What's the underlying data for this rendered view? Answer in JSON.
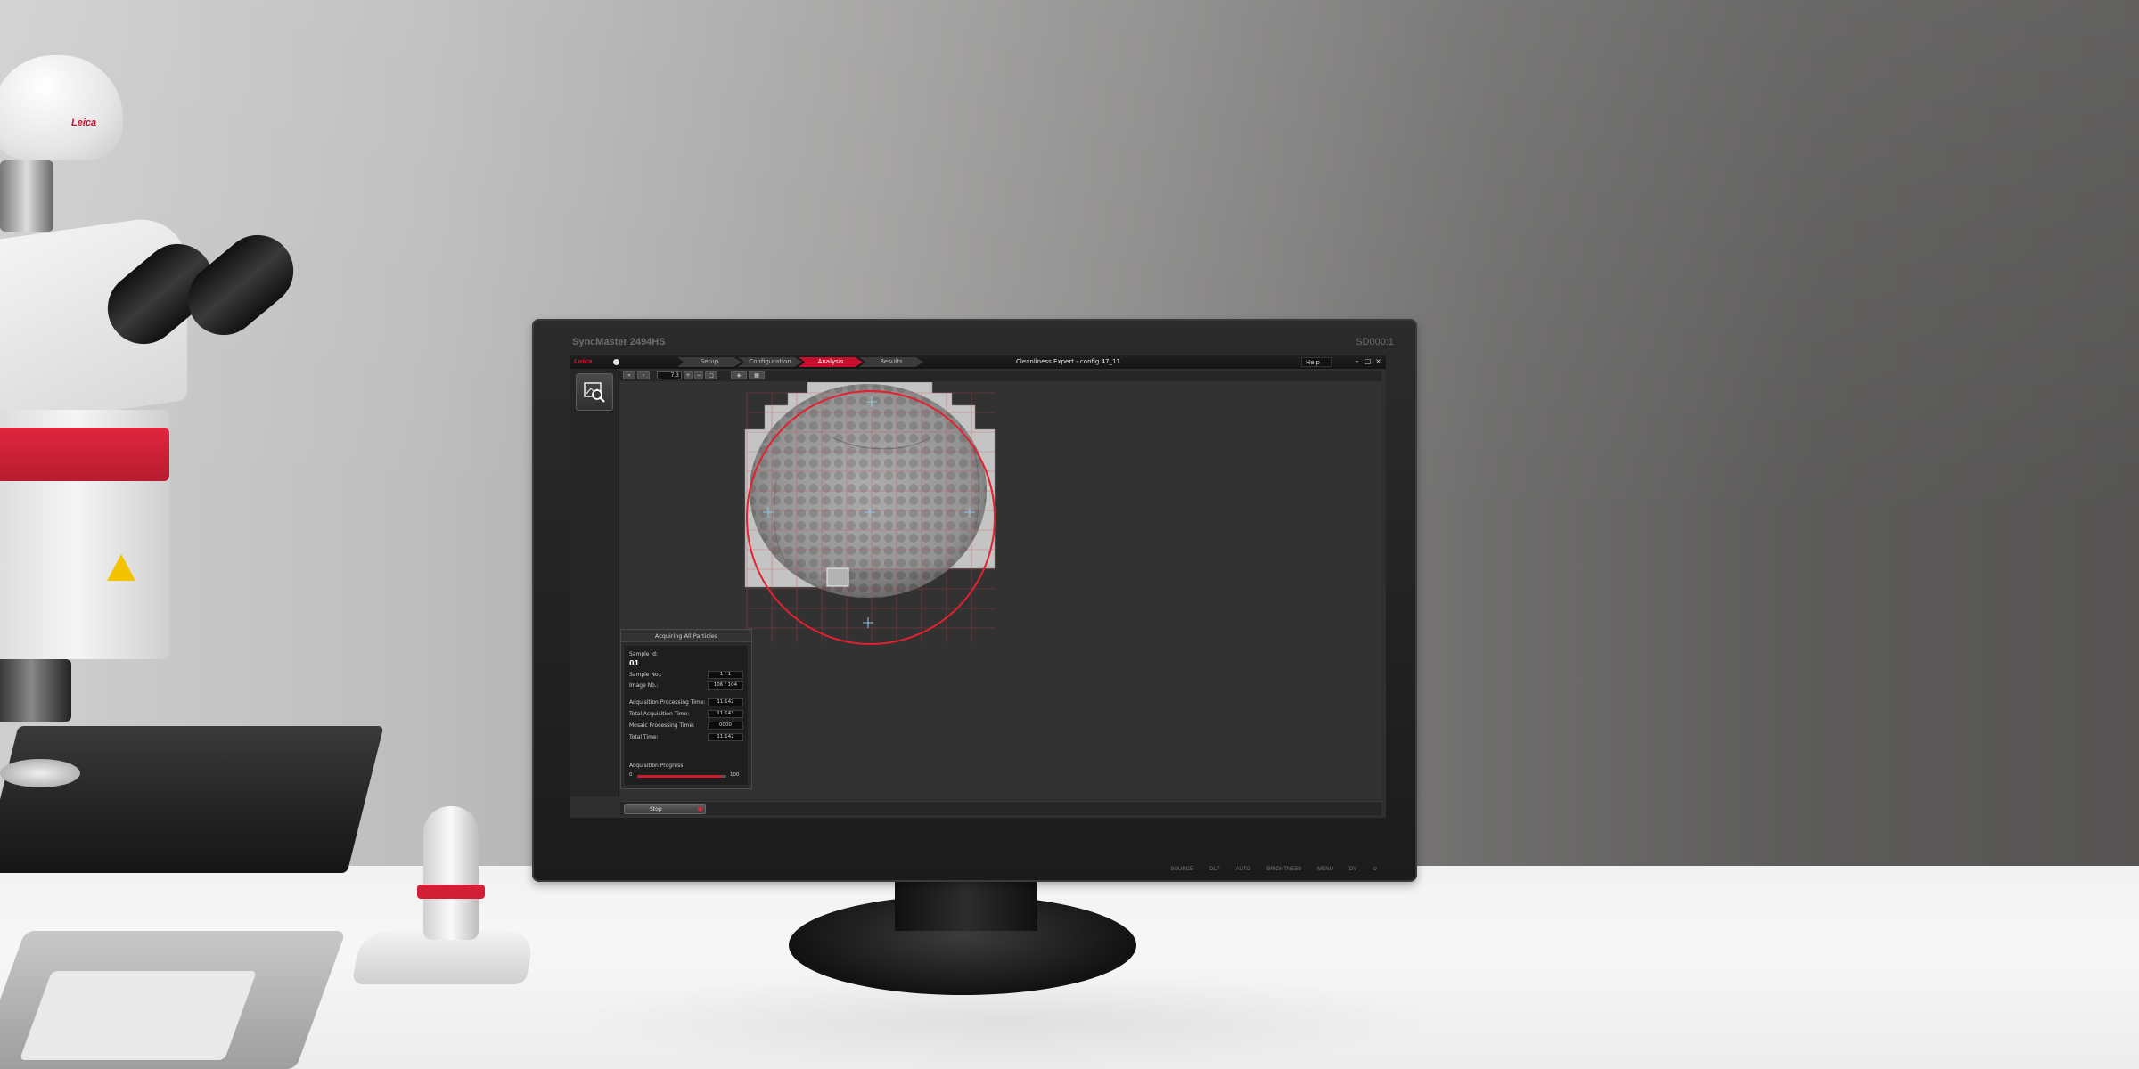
{
  "monitor": {
    "brand": "SyncMaster 2494HS",
    "logo": "SD000:1",
    "controls": [
      "SOURCE",
      "DLP",
      "AUTO",
      "BRIGHTNESS",
      "MENU",
      "DV",
      "⏻"
    ]
  },
  "app": {
    "logo": "Leica",
    "window_title": "Cleanliness Expert - config 47_11",
    "help_label": "Help",
    "window_controls": [
      "–",
      "□",
      "×"
    ],
    "workflow_tabs": [
      {
        "label": "Setup",
        "state": "done"
      },
      {
        "label": "Configuration",
        "state": "done"
      },
      {
        "label": "Analysis",
        "state": "active"
      },
      {
        "label": "Results",
        "state": "pending"
      }
    ],
    "toolbar": {
      "zoom_value": "7.3"
    },
    "analysis_tool_icon": "image-search-icon",
    "status_panel": {
      "title": "Acquiring All Particles",
      "sample_id_label": "Sample Id:",
      "sample_id": "01",
      "rows": [
        {
          "label": "Sample No.:",
          "value": "1 / 1"
        },
        {
          "label": "Image No.:",
          "value": "106 / 104"
        },
        {
          "label": "Acquisition Processing Time:",
          "value": "11:142"
        },
        {
          "label": "Total Acquisition Time:",
          "value": "11:143"
        },
        {
          "label": "Mosaic Processing Time:",
          "value": "0000"
        },
        {
          "label": "Total Time:",
          "value": "11:142"
        }
      ],
      "progress_label": "Acquisition Progress",
      "progress_min": "0",
      "progress_max": "100",
      "progress_value": 0.95
    },
    "stop_label": "Stop",
    "accent_color": "#c8102e"
  },
  "microscope": {
    "logo": "Leica"
  }
}
